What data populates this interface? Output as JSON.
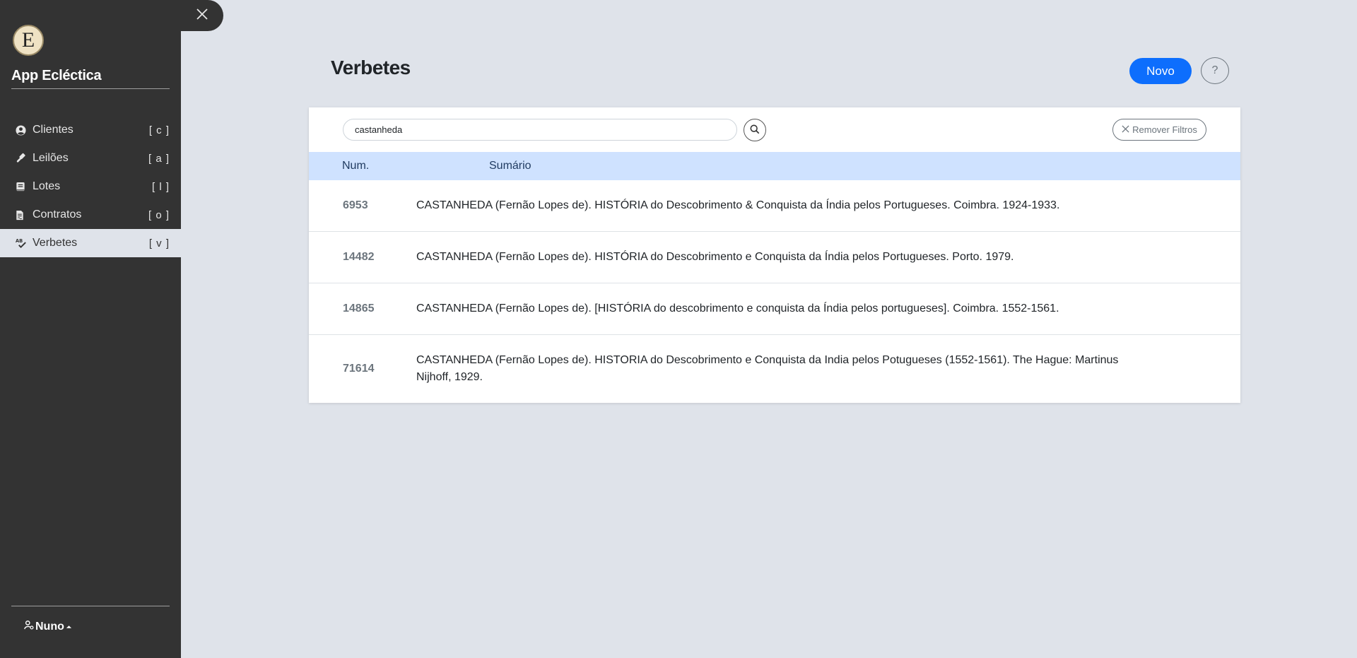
{
  "sidebar": {
    "app_title": "App Ecléctica",
    "logo_letter": "E",
    "items": [
      {
        "label": "Clientes",
        "key": "[ c ]",
        "icon": "user-circle-icon"
      },
      {
        "label": "Leilões",
        "key": "[ a ]",
        "icon": "gavel-icon"
      },
      {
        "label": "Lotes",
        "key": "[ l ]",
        "icon": "book-icon"
      },
      {
        "label": "Contratos",
        "key": "[ o ]",
        "icon": "file-contract-icon"
      },
      {
        "label": "Verbetes",
        "key": "[ v ]",
        "icon": "spell-check-icon"
      }
    ],
    "active_item": "Verbetes",
    "user": "Nuno"
  },
  "main": {
    "title": "Verbetes",
    "new_button": "Novo",
    "help_button": "?",
    "search": {
      "value": "castanheda"
    },
    "remove_filters": "Remover Filtros",
    "table": {
      "columns": [
        "Num.",
        "Sumário"
      ],
      "rows": [
        {
          "num": "6953",
          "summary": "CASTANHEDA (Fernão Lopes de). HISTÓRIA do Descobrimento & Conquista da Índia pelos Portugueses. Coimbra. 1924-1933."
        },
        {
          "num": "14482",
          "summary": "CASTANHEDA (Fernão Lopes de). HISTÓRIA do Descobrimento e Conquista da Índia pelos Portugueses. Porto. 1979."
        },
        {
          "num": "14865",
          "summary": "CASTANHEDA (Fernão Lopes de). [HISTÓRIA do descobrimento e conquista da Índia pelos portugueses]. Coimbra. 1552-1561."
        },
        {
          "num": "71614",
          "summary": "CASTANHEDA (Fernão Lopes de). HISTORIA do Descobrimento e Conquista da India pelos Potugueses (1552-1561). The Hague: Martinus Nijhoff, 1929."
        }
      ]
    }
  },
  "colors": {
    "sidebar_bg": "#333333",
    "page_bg": "#dfe3ea",
    "accent": "#0d6efd",
    "table_header_bg": "#cfe2ff"
  }
}
